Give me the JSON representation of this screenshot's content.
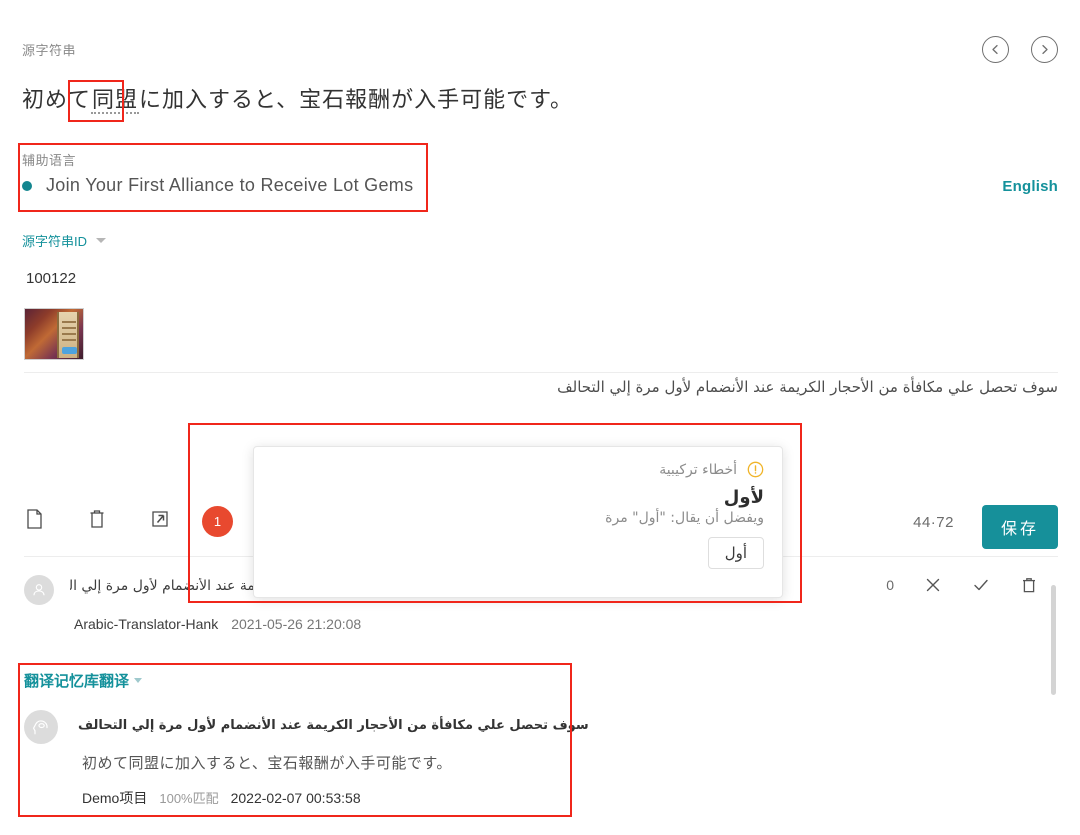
{
  "header": {
    "source_label": "源字符串",
    "prev_icon": "chevron-left-circle-icon",
    "next_icon": "chevron-right-circle-icon",
    "source_text_before": "初めて",
    "source_text_term": "同盟",
    "source_text_after": "に加入すると、宝石報酬が入手可能です。"
  },
  "auxiliary": {
    "label": "辅助语言",
    "text": "Join Your First Alliance to Receive Lot Gems",
    "language": "English",
    "dot_color": "#13868f"
  },
  "source_id": {
    "label": "源字符串ID",
    "value": "100122"
  },
  "arabic_source": "سوف تحصل علي مكافأة من الأحجار الكريمة عند الأنضمام لأول مرة إلي التحالف",
  "toolbar": {
    "copy_icon": "copy-icon",
    "delete_icon": "trash-icon",
    "expand_icon": "expand-arrow-icon",
    "badge_count": "1",
    "char_count": "44·72",
    "save_label": "保存",
    "save_color": "#16909a"
  },
  "tooltip": {
    "warning_icon": "warning-circle-icon",
    "heading": "أخطاء تركيبية",
    "term": "لأول",
    "suggestion": "ويفضل أن يقال: \"أول\" مرة",
    "chip_label": "أول"
  },
  "comment": {
    "avatar_icon": "user-avatar-icon",
    "text": "سوف تحصل علي مكافأة من الأحجار الكريمة عند الأنضمام لأول مرة إلي التحالف",
    "author": "Arabic-Translator-Hank",
    "timestamp": "2021-05-26 21:20:08",
    "vote_count": "0",
    "reject_icon": "x-icon",
    "approve_icon": "check-icon",
    "delete_icon": "trash-icon"
  },
  "translation_memory": {
    "title": "翻译记忆库翻译",
    "avatar_icon": "machine-translation-head-icon",
    "arabic": "سوف تحصل علي مكافأة من الأحجار الكريمة عند الأنضمام لأول مرة إلي التحالف",
    "japanese": "初めて同盟に加入すると、宝石報酬が入手可能です。",
    "project": "Demo项目",
    "match": "100%匹配",
    "date": "2022-02-07 00:53:58"
  }
}
